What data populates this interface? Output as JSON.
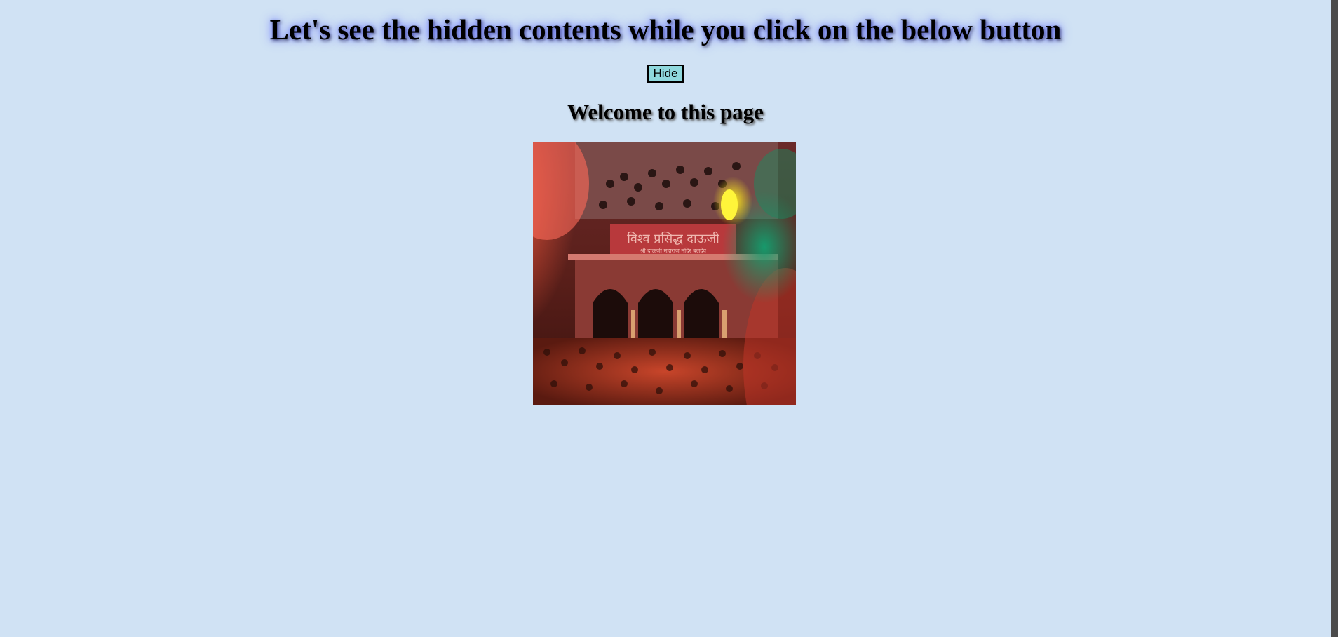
{
  "heading": "Let's see the hidden contents while you click on the below button",
  "toggle_button": "Hide",
  "welcome": "Welcome to this page",
  "photo": {
    "sign_text": "विश्व प्रसिद्ध दाऊजी",
    "sign_subtext": "श्री दाऊजी महाराज मंदिर बलदेव"
  },
  "colors": {
    "background": "#d0e2f4",
    "button_bg": "#8fd8dd",
    "heading_glow": "#6f7cff"
  }
}
